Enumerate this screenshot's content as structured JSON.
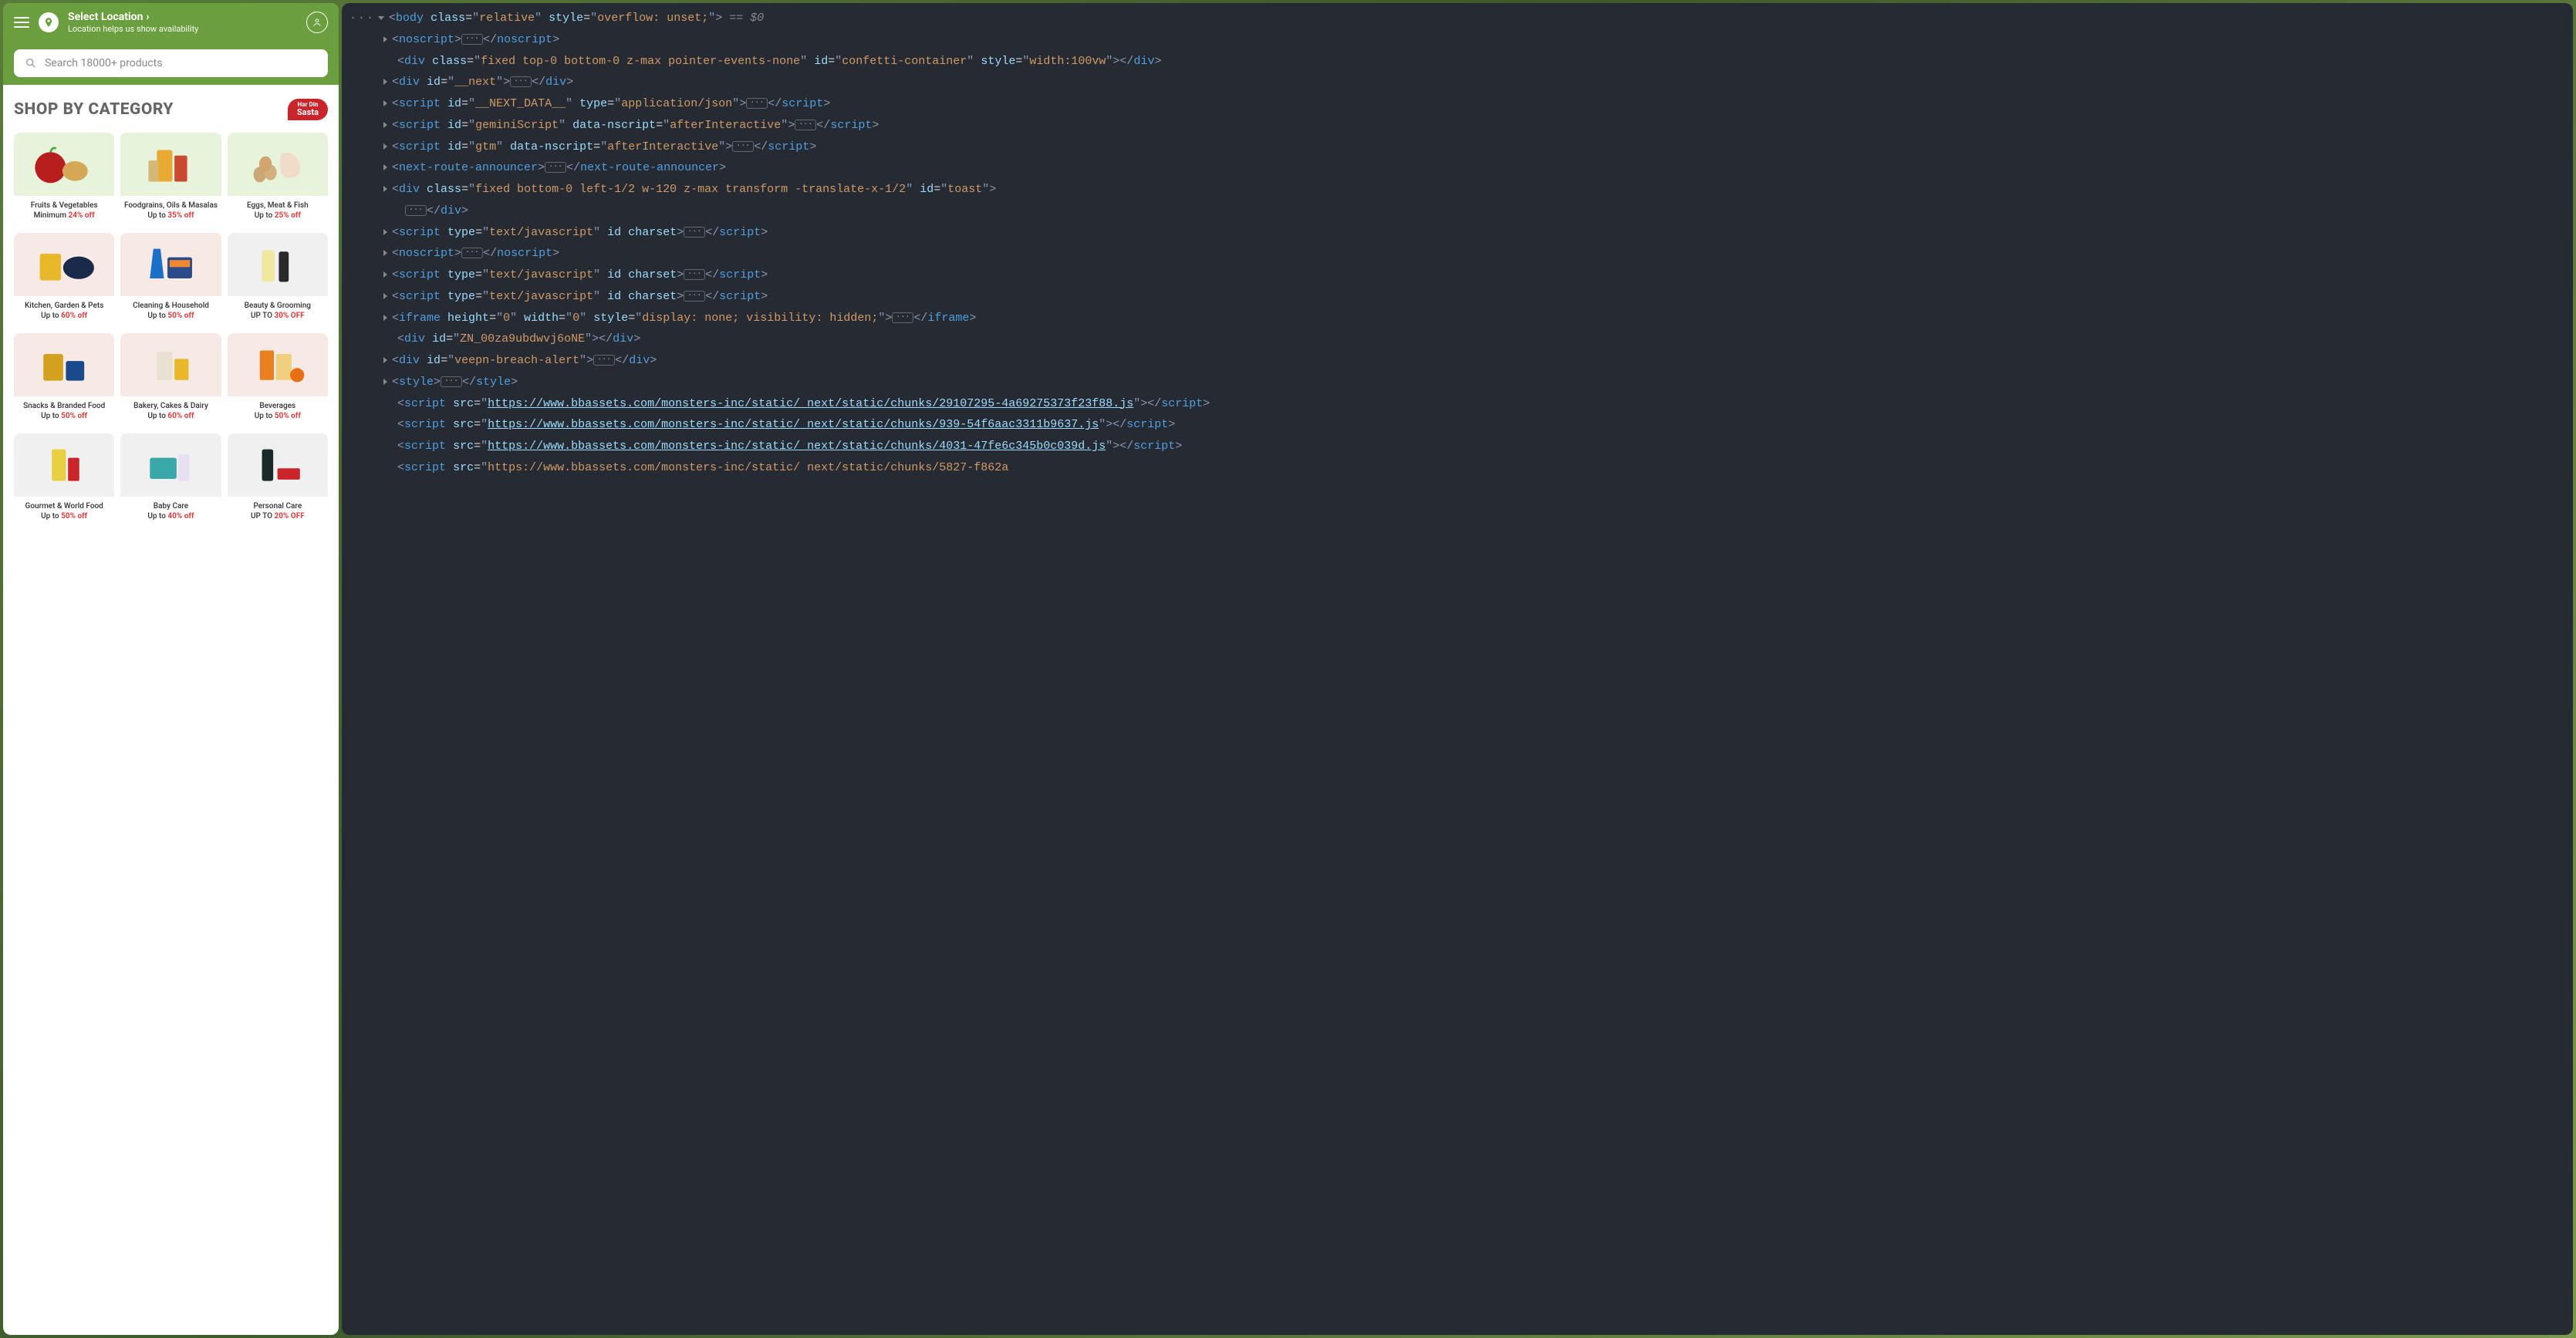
{
  "header": {
    "location_label": "Select Location",
    "location_sub": "Location helps us show availability",
    "search_placeholder": "Search 18000+ products"
  },
  "section": {
    "title": "SHOP BY CATEGORY",
    "badge_top": "Har Din",
    "badge_bottom": "Sasta"
  },
  "categories": [
    {
      "name": "Fruits & Vegetables",
      "offer_prefix": "Minimum ",
      "offer_pct": "24% off",
      "bg": "green"
    },
    {
      "name": "Foodgrains, Oils & Masalas",
      "offer_prefix": "Up to ",
      "offer_pct": "35% off",
      "bg": "green"
    },
    {
      "name": "Eggs, Meat & Fish",
      "offer_prefix": "Up to ",
      "offer_pct": "25% off",
      "bg": "green"
    },
    {
      "name": "Kitchen, Garden & Pets",
      "offer_prefix": "Up to ",
      "offer_pct": "60% off",
      "bg": "pink"
    },
    {
      "name": "Cleaning & Household",
      "offer_prefix": "Up to ",
      "offer_pct": "50% off",
      "bg": "pink"
    },
    {
      "name": "Beauty & Grooming",
      "offer_prefix": "UP TO ",
      "offer_pct": "30% OFF",
      "bg": "gray"
    },
    {
      "name": "Snacks & Branded Food",
      "offer_prefix": "Up to ",
      "offer_pct": "50% off",
      "bg": "pink"
    },
    {
      "name": "Bakery, Cakes & Dairy",
      "offer_prefix": "Up to ",
      "offer_pct": "60% off",
      "bg": "pink"
    },
    {
      "name": "Beverages",
      "offer_prefix": "Up to ",
      "offer_pct": "50% off",
      "bg": "pink"
    },
    {
      "name": "Gourmet & World Food",
      "offer_prefix": "Up to ",
      "offer_pct": "50% off",
      "bg": "gray"
    },
    {
      "name": "Baby Care",
      "offer_prefix": "Up to ",
      "offer_pct": "40% off",
      "bg": "gray"
    },
    {
      "name": "Personal Care",
      "offer_prefix": "UP TO ",
      "offer_pct": "20% OFF",
      "bg": "gray"
    }
  ],
  "dom_tokens": [
    {
      "indent": 0,
      "html": "<span class='dots'>···</span><span class='caret caret-down'></span><span class='t-bracket'>&lt;</span><span class='t-tag'>body</span> <span class='t-attr'>class</span><span class='t-eq'>=</span><span class='t-punct'>\"</span><span class='t-str'>relative</span><span class='t-punct'>\"</span> <span class='t-attr'>style</span><span class='t-eq'>=</span><span class='t-punct'>\"</span><span class='t-str'>overflow: unset;</span><span class='t-punct'>\"</span><span class='t-bracket'>&gt;</span> <span class='t-comment'>== $0</span>"
    },
    {
      "indent": 1,
      "html": "<span class='caret'></span><span class='t-bracket'>&lt;</span><span class='t-tag'>noscript</span><span class='t-bracket'>&gt;</span><span class='ellip'>···</span><span class='t-bracket'>&lt;/</span><span class='t-tag'>noscript</span><span class='t-bracket'>&gt;</span>"
    },
    {
      "indent": 1,
      "html": "&nbsp;&nbsp;<span class='t-bracket'>&lt;</span><span class='t-tag'>div</span> <span class='t-attr'>class</span><span class='t-eq'>=</span><span class='t-punct'>\"</span><span class='t-str'>fixed top-0 bottom-0 z-max pointer-events-none</span><span class='t-punct'>\"</span> <span class='t-attr'>id</span><span class='t-eq'>=</span><span class='t-punct'>\"</span><span class='t-str'>confetti-container</span><span class='t-punct'>\"</span> <span class='t-attr'>style</span><span class='t-eq'>=</span><span class='t-punct'>\"</span><span class='t-str'>width:100vw</span><span class='t-punct'>\"</span><span class='t-bracket'>&gt;&lt;/</span><span class='t-tag'>div</span><span class='t-bracket'>&gt;</span>"
    },
    {
      "indent": 1,
      "html": "<span class='caret'></span><span class='t-bracket'>&lt;</span><span class='t-tag'>div</span> <span class='t-attr'>id</span><span class='t-eq'>=</span><span class='t-punct'>\"</span><span class='t-str'>__next</span><span class='t-punct'>\"</span><span class='t-bracket'>&gt;</span><span class='ellip'>···</span><span class='t-bracket'>&lt;/</span><span class='t-tag'>div</span><span class='t-bracket'>&gt;</span>"
    },
    {
      "indent": 1,
      "html": "<span class='caret'></span><span class='t-bracket'>&lt;</span><span class='t-tag'>script</span> <span class='t-attr'>id</span><span class='t-eq'>=</span><span class='t-punct'>\"</span><span class='t-str'>__NEXT_DATA__</span><span class='t-punct'>\"</span> <span class='t-attr'>type</span><span class='t-eq'>=</span><span class='t-punct'>\"</span><span class='t-str'>application/json</span><span class='t-punct'>\"</span><span class='t-bracket'>&gt;</span><span class='ellip'>···</span><span class='t-bracket'>&lt;/</span><span class='t-tag'>script</span><span class='t-bracket'>&gt;</span>"
    },
    {
      "indent": 1,
      "html": "<span class='caret'></span><span class='t-bracket'>&lt;</span><span class='t-tag'>script</span> <span class='t-attr'>id</span><span class='t-eq'>=</span><span class='t-punct'>\"</span><span class='t-str'>geminiScript</span><span class='t-punct'>\"</span> <span class='t-attr'>data-nscript</span><span class='t-eq'>=</span><span class='t-punct'>\"</span><span class='t-str'>afterInteractive</span><span class='t-punct'>\"</span><span class='t-bracket'>&gt;</span><span class='ellip'>···</span><span class='t-bracket'>&lt;/</span><span class='t-tag'>script</span><span class='t-bracket'>&gt;</span>"
    },
    {
      "indent": 1,
      "html": "<span class='caret'></span><span class='t-bracket'>&lt;</span><span class='t-tag'>script</span> <span class='t-attr'>id</span><span class='t-eq'>=</span><span class='t-punct'>\"</span><span class='t-str'>gtm</span><span class='t-punct'>\"</span> <span class='t-attr'>data-nscript</span><span class='t-eq'>=</span><span class='t-punct'>\"</span><span class='t-str'>afterInteractive</span><span class='t-punct'>\"</span><span class='t-bracket'>&gt;</span><span class='ellip'>···</span><span class='t-bracket'>&lt;/</span><span class='t-tag'>script</span><span class='t-bracket'>&gt;</span>"
    },
    {
      "indent": 1,
      "html": "<span class='caret'></span><span class='t-bracket'>&lt;</span><span class='t-tag'>next-route-announcer</span><span class='t-bracket'>&gt;</span><span class='ellip'>···</span><span class='t-bracket'>&lt;/</span><span class='t-tag'>next-route-announcer</span><span class='t-bracket'>&gt;</span>"
    },
    {
      "indent": 1,
      "html": "<span class='caret'></span><span class='t-bracket'>&lt;</span><span class='t-tag'>div</span> <span class='t-attr'>class</span><span class='t-eq'>=</span><span class='t-punct'>\"</span><span class='t-str'>fixed bottom-0 left-1/2 w-120 z-max transform -translate-x-1/2</span><span class='t-punct'>\"</span> <span class='t-attr'>id</span><span class='t-eq'>=</span><span class='t-punct'>\"</span><span class='t-str'>toast</span><span class='t-punct'>\"</span><span class='t-bracket'>&gt;</span>"
    },
    {
      "indent": 2,
      "html": "<span class='ellip'>···</span><span class='t-bracket'>&lt;/</span><span class='t-tag'>div</span><span class='t-bracket'>&gt;</span>"
    },
    {
      "indent": 1,
      "html": "<span class='caret'></span><span class='t-bracket'>&lt;</span><span class='t-tag'>script</span> <span class='t-attr'>type</span><span class='t-eq'>=</span><span class='t-punct'>\"</span><span class='t-str'>text/javascript</span><span class='t-punct'>\"</span> <span class='t-attr'>id</span> <span class='t-attr'>charset</span><span class='t-bracket'>&gt;</span><span class='ellip'>···</span><span class='t-bracket'>&lt;/</span><span class='t-tag'>script</span><span class='t-bracket'>&gt;</span>"
    },
    {
      "indent": 1,
      "html": "<span class='caret'></span><span class='t-bracket'>&lt;</span><span class='t-tag'>noscript</span><span class='t-bracket'>&gt;</span><span class='ellip'>···</span><span class='t-bracket'>&lt;/</span><span class='t-tag'>noscript</span><span class='t-bracket'>&gt;</span>"
    },
    {
      "indent": 1,
      "html": "<span class='caret'></span><span class='t-bracket'>&lt;</span><span class='t-tag'>script</span> <span class='t-attr'>type</span><span class='t-eq'>=</span><span class='t-punct'>\"</span><span class='t-str'>text/javascript</span><span class='t-punct'>\"</span> <span class='t-attr'>id</span> <span class='t-attr'>charset</span><span class='t-bracket'>&gt;</span><span class='ellip'>···</span><span class='t-bracket'>&lt;/</span><span class='t-tag'>script</span><span class='t-bracket'>&gt;</span>"
    },
    {
      "indent": 1,
      "html": "<span class='caret'></span><span class='t-bracket'>&lt;</span><span class='t-tag'>script</span> <span class='t-attr'>type</span><span class='t-eq'>=</span><span class='t-punct'>\"</span><span class='t-str'>text/javascript</span><span class='t-punct'>\"</span> <span class='t-attr'>id</span> <span class='t-attr'>charset</span><span class='t-bracket'>&gt;</span><span class='ellip'>···</span><span class='t-bracket'>&lt;/</span><span class='t-tag'>script</span><span class='t-bracket'>&gt;</span>"
    },
    {
      "indent": 1,
      "html": "<span class='caret'></span><span class='t-bracket'>&lt;</span><span class='t-tag'>iframe</span> <span class='t-attr'>height</span><span class='t-eq'>=</span><span class='t-punct'>\"</span><span class='t-str'>0</span><span class='t-punct'>\"</span> <span class='t-attr'>width</span><span class='t-eq'>=</span><span class='t-punct'>\"</span><span class='t-str'>0</span><span class='t-punct'>\"</span> <span class='t-attr'>style</span><span class='t-eq'>=</span><span class='t-punct'>\"</span><span class='t-str'>display: none; visibility: hidden;</span><span class='t-punct'>\"</span><span class='t-bracket'>&gt;</span><span class='ellip'>···</span><span class='t-bracket'>&lt;/</span><span class='t-tag'>iframe</span><span class='t-bracket'>&gt;</span>"
    },
    {
      "indent": 1,
      "html": "&nbsp;&nbsp;<span class='t-bracket'>&lt;</span><span class='t-tag'>div</span> <span class='t-attr'>id</span><span class='t-eq'>=</span><span class='t-punct'>\"</span><span class='t-str'>ZN_00za9ubdwvj6oNE</span><span class='t-punct'>\"</span><span class='t-bracket'>&gt;&lt;/</span><span class='t-tag'>div</span><span class='t-bracket'>&gt;</span>"
    },
    {
      "indent": 1,
      "html": "<span class='caret'></span><span class='t-bracket'>&lt;</span><span class='t-tag'>div</span> <span class='t-attr'>id</span><span class='t-eq'>=</span><span class='t-punct'>\"</span><span class='t-str'>veepn-breach-alert</span><span class='t-punct'>\"</span><span class='t-bracket'>&gt;</span><span class='ellip'>···</span><span class='t-bracket'>&lt;/</span><span class='t-tag'>div</span><span class='t-bracket'>&gt;</span>"
    },
    {
      "indent": 1,
      "html": "<span class='caret'></span><span class='t-bracket'>&lt;</span><span class='t-tag'>style</span><span class='t-bracket'>&gt;</span><span class='ellip'>···</span><span class='t-bracket'>&lt;/</span><span class='t-tag'>style</span><span class='t-bracket'>&gt;</span>"
    },
    {
      "indent": 1,
      "html": "&nbsp;&nbsp;<span class='t-bracket'>&lt;</span><span class='t-tag'>script</span> <span class='t-attr'>src</span><span class='t-eq'>=</span><span class='t-punct'>\"</span><span class='t-link'>https://www.bbassets.com/monsters-inc/static/ next/static/chunks/29107295-4a69275373f23f88.js</span><span class='t-punct'>\"</span><span class='t-bracket'>&gt;&lt;/</span><span class='t-tag'>script</span><span class='t-bracket'>&gt;</span>"
    },
    {
      "indent": 1,
      "html": "&nbsp;&nbsp;<span class='t-bracket'>&lt;</span><span class='t-tag'>script</span> <span class='t-attr'>src</span><span class='t-eq'>=</span><span class='t-punct'>\"</span><span class='t-link'>https://www.bbassets.com/monsters-inc/static/ next/static/chunks/939-54f6aac3311b9637.js</span><span class='t-punct'>\"</span><span class='t-bracket'>&gt;&lt;/</span><span class='t-tag'>script</span><span class='t-bracket'>&gt;</span>"
    },
    {
      "indent": 1,
      "html": "&nbsp;&nbsp;<span class='t-bracket'>&lt;</span><span class='t-tag'>script</span> <span class='t-attr'>src</span><span class='t-eq'>=</span><span class='t-punct'>\"</span><span class='t-link'>https://www.bbassets.com/monsters-inc/static/ next/static/chunks/4031-47fe6c345b0c039d.js</span><span class='t-punct'>\"</span><span class='t-bracket'>&gt;&lt;/</span><span class='t-tag'>script</span><span class='t-bracket'>&gt;</span>"
    },
    {
      "indent": 1,
      "html": "&nbsp;&nbsp;<span class='t-bracket'>&lt;</span><span class='t-tag'>script</span> <span class='t-attr'>src</span><span class='t-eq'>=</span><span class='t-punct'>\"</span><span class='t-str'>https://www.bbassets.com/monsters-inc/static/ next/static/chunks/5827-f862a</span>"
    }
  ]
}
